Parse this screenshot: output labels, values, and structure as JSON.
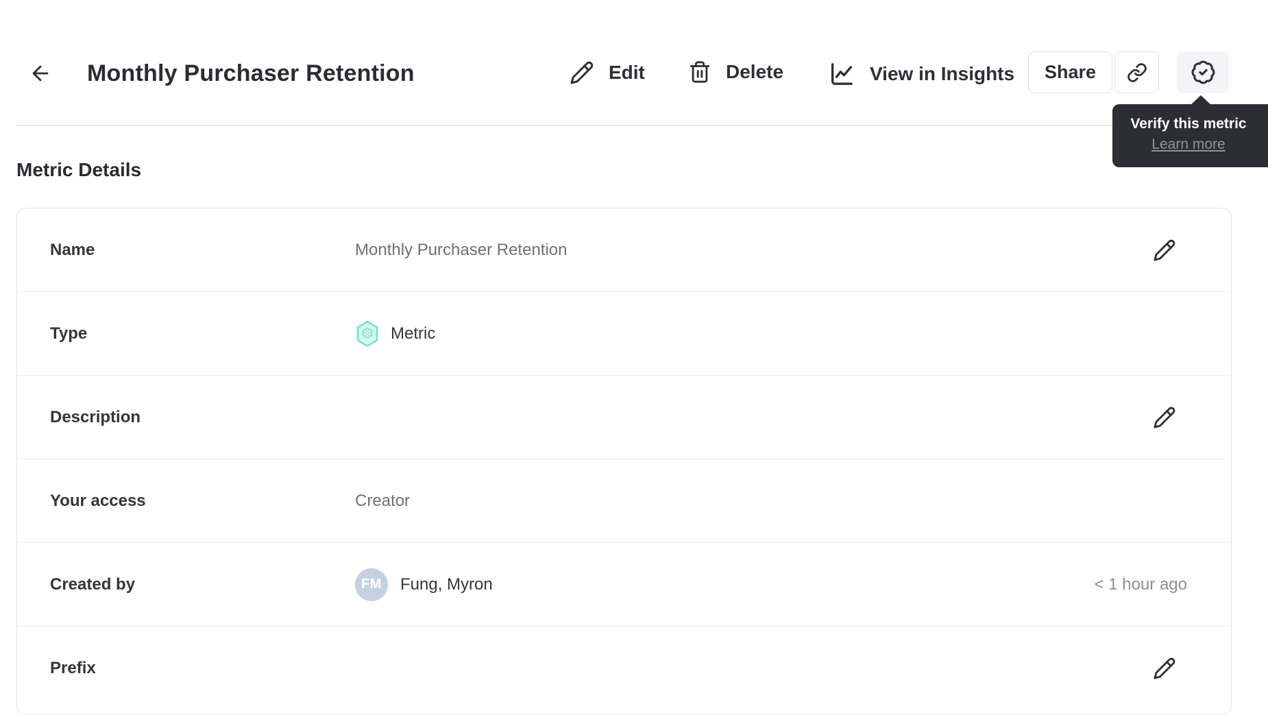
{
  "header": {
    "title": "Monthly Purchaser Retention",
    "edit_label": "Edit",
    "delete_label": "Delete",
    "insights_label": "View in Insights",
    "share_label": "Share"
  },
  "tooltip": {
    "title": "Verify this metric",
    "link_label": "Learn more"
  },
  "metric_details": {
    "heading": "Metric Details",
    "rows": [
      {
        "label": "Name",
        "value": "Monthly Purchaser Retention"
      },
      {
        "label": "Type",
        "value": "Metric"
      },
      {
        "label": "Description",
        "value": ""
      },
      {
        "label": "Your access",
        "value": "Creator"
      },
      {
        "label": "Created by",
        "value": "Fung, Myron",
        "avatar_initials": "FM",
        "timestamp": "< 1 hour ago"
      },
      {
        "label": "Prefix",
        "value": ""
      }
    ]
  },
  "colors": {
    "accent_teal_stroke": "#7ce0d0",
    "accent_teal_fill": "#d9f6f1",
    "accent_teal_inner": "#96e7d8",
    "tooltip_bg": "#2d2d34",
    "avatar_bg": "#c5d1e1",
    "text_dark": "#2b2b33",
    "text_gray": "#6f6f79",
    "timestamp_gray": "#8d8d96",
    "divider": "#ececef",
    "verify_button_bg": "#f4f4f8"
  }
}
